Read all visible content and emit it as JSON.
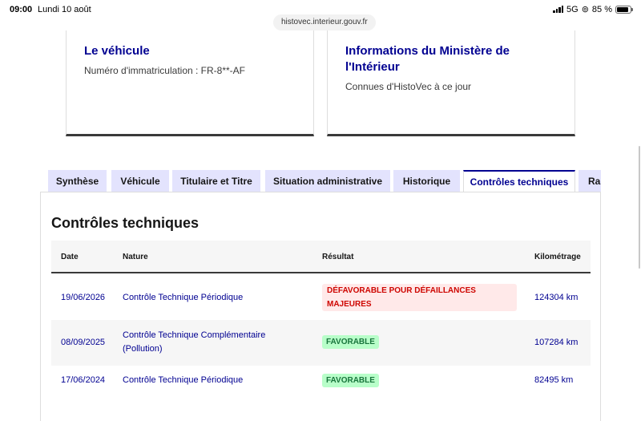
{
  "status_bar": {
    "time": "09:00",
    "date": "Lundi 10 août",
    "network": "5G",
    "battery": "85 %",
    "battery_level_percent": 85
  },
  "browser": {
    "url": "histovec.interieur.gouv.fr"
  },
  "cards": [
    {
      "title": "Le véhicule",
      "text": "Numéro d'immatriculation : FR-8**-AF"
    },
    {
      "title": "Informations du Ministère de l'Intérieur",
      "text": "Connues d'HistoVec à ce jour"
    }
  ],
  "tabs": [
    {
      "label": "Synthèse",
      "active": false
    },
    {
      "label": "Véhicule",
      "active": false
    },
    {
      "label": "Titulaire et Titre",
      "active": false
    },
    {
      "label": "Situation administrative",
      "active": false
    },
    {
      "label": "Historique",
      "active": false
    },
    {
      "label": "Contrôles techniques",
      "active": true
    },
    {
      "label": "Rap",
      "active": false
    }
  ],
  "section": {
    "title": "Contrôles techniques",
    "columns": [
      "Date",
      "Nature",
      "Résultat",
      "Kilométrage"
    ],
    "rows": [
      {
        "date": "19/06/2026",
        "nature": "Contrôle Technique Périodique",
        "result": "DÉFAVORABLE POUR DÉFAILLANCES MAJEURES",
        "result_status": "error",
        "km": "124304 km"
      },
      {
        "date": "08/09/2025",
        "nature": "Contrôle Technique Complémentaire (Pollution)",
        "result": "FAVORABLE",
        "result_status": "success",
        "km": "107284 km"
      },
      {
        "date": "17/06/2024",
        "nature": "Contrôle Technique Périodique",
        "result": "FAVORABLE",
        "result_status": "success",
        "km": "82495 km"
      }
    ]
  },
  "colors": {
    "primary_blue": "#000091",
    "tab_bg": "#e3e3fd",
    "error_bg": "#ffe9e9",
    "error_text": "#ce0500",
    "success_bg": "#b8fec9",
    "success_text": "#18753c"
  }
}
